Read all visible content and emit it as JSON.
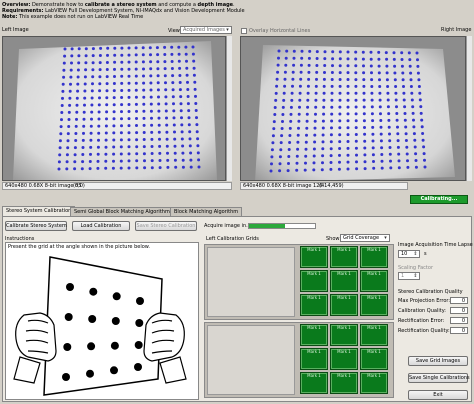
{
  "header": {
    "overview_label": "Overview:",
    "overview_text_pre": " Demonstrate how to ",
    "overview_bold_1": "calibrate a stereo system",
    "overview_text_mid": " and compute a ",
    "overview_bold_2": "depth image",
    "overview_text_end": ".",
    "requirements_label": "Requirements:",
    "requirements_text": " LabVIEW Full Development System, NI-IMAQdx and Vision Development Module",
    "note_label": "Note:",
    "note_text": " This example does not run on LabVIEW Real Time"
  },
  "left_image": {
    "label": "Left Image",
    "view_label": "View",
    "view_value": "Acquired Images",
    "info": "640x480 0.68X 8-bit image 85",
    "coords": "(0,0)"
  },
  "overlay": {
    "label": "Overlay Horizontal Lines",
    "checked": false
  },
  "right_image": {
    "label": "Right Image",
    "info": "640x480 0.68X 8-bit image 126",
    "coords": "(414,459)"
  },
  "status": {
    "calibrating": "Calibrating..."
  },
  "tabs": [
    {
      "label": "Stereo System Calibration",
      "active": true
    },
    {
      "label": "Semi Global Block Matching Algorithm",
      "active": false
    },
    {
      "label": "Block Matching Algorithm",
      "active": false
    }
  ],
  "buttons": {
    "calibrate_stereo": "Calibrate Stereo System",
    "load_calibration": "Load Calibration",
    "save_stereo_calibration": "Save Stereo Calibration",
    "save_grid_images": "Save Grid Images",
    "save_single_calibrations": "Save Single Calibrations",
    "exit": "Exit"
  },
  "acquire": {
    "label": "Acquire image in...",
    "progress": 0.55
  },
  "instructions": {
    "label": "Instructions",
    "text": "Present the grid at the angle shown in the picture below."
  },
  "grids": {
    "left_label": "Left Calibration Grids",
    "show_label": "Show",
    "show_value": "Grid Coverage",
    "cell_text": "Mark 1"
  },
  "settings": {
    "lapse_label": "Image Acquisition Time Lapse",
    "lapse_value": "10",
    "lapse_unit": "s",
    "scaling_label": "Scaling Factor",
    "scaling_value": "1",
    "quality_header": "Stereo Calibration Quality",
    "max_proj_label": "Max Projection Error:",
    "max_proj_value": "0",
    "calib_quality_label": "Calibration Quality:",
    "calib_quality_value": "0",
    "rect_error_label": "Rectification Error:",
    "rect_error_value": "0",
    "rect_quality_label": "Rectification Quality:",
    "rect_quality_value": "0"
  },
  "colors": {
    "dot": "#3333cc",
    "status_green": "#1c9a2c",
    "grid_green": "#0a7a1c"
  }
}
